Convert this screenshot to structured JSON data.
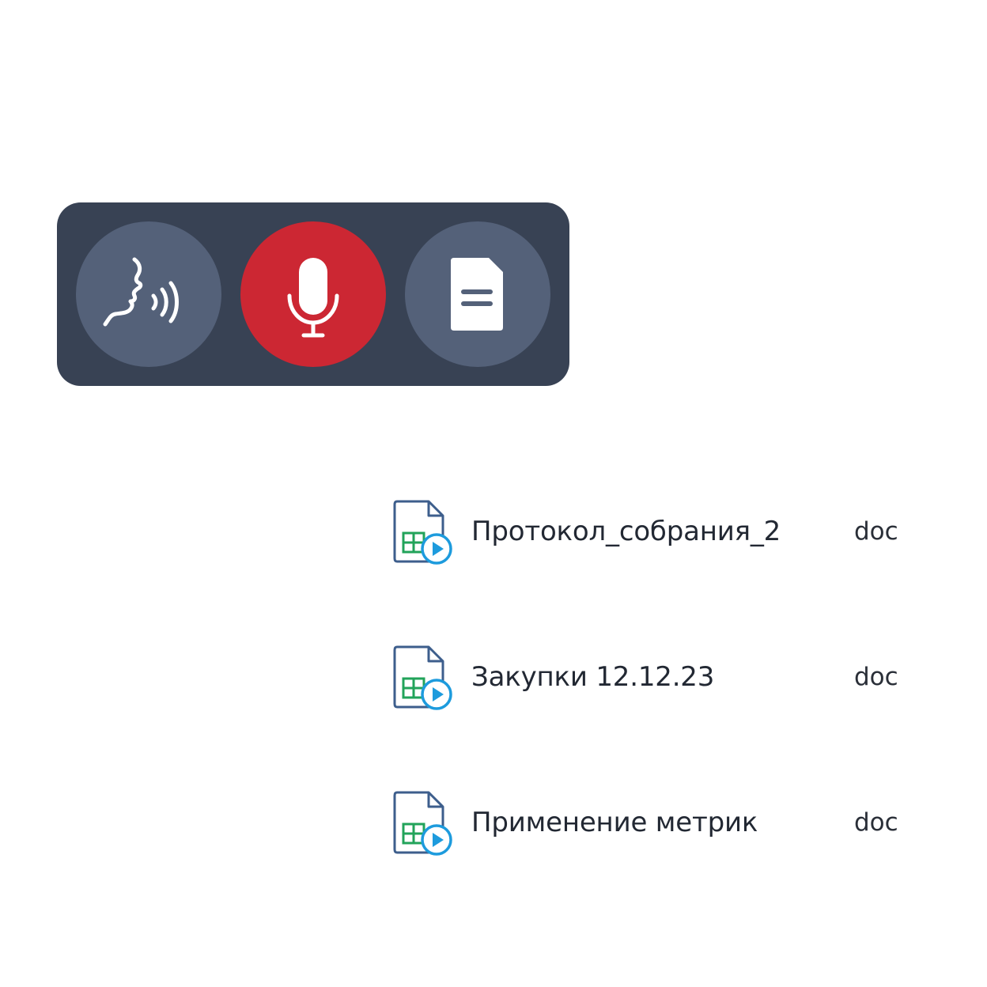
{
  "toolbar": {
    "buttons": [
      {
        "name": "speech",
        "icon": "speaking-head-icon"
      },
      {
        "name": "record",
        "icon": "microphone-icon",
        "active": true
      },
      {
        "name": "document",
        "icon": "document-icon"
      }
    ]
  },
  "files": [
    {
      "name": "Протокол_собрания_2",
      "ext": "doc",
      "icon": "spreadsheet-video-file-icon"
    },
    {
      "name": "Закупки 12.12.23",
      "ext": "doc",
      "icon": "spreadsheet-video-file-icon"
    },
    {
      "name": "Применение метрик",
      "ext": "doc",
      "icon": "spreadsheet-video-file-icon"
    }
  ],
  "colors": {
    "toolbar_bg": "#384254",
    "button_bg": "#546179",
    "record_active": "#cc2733",
    "file_outline": "#3d5e8c",
    "grid_green": "#22a35a",
    "play_blue": "#1d9bdd",
    "text": "#222833"
  }
}
